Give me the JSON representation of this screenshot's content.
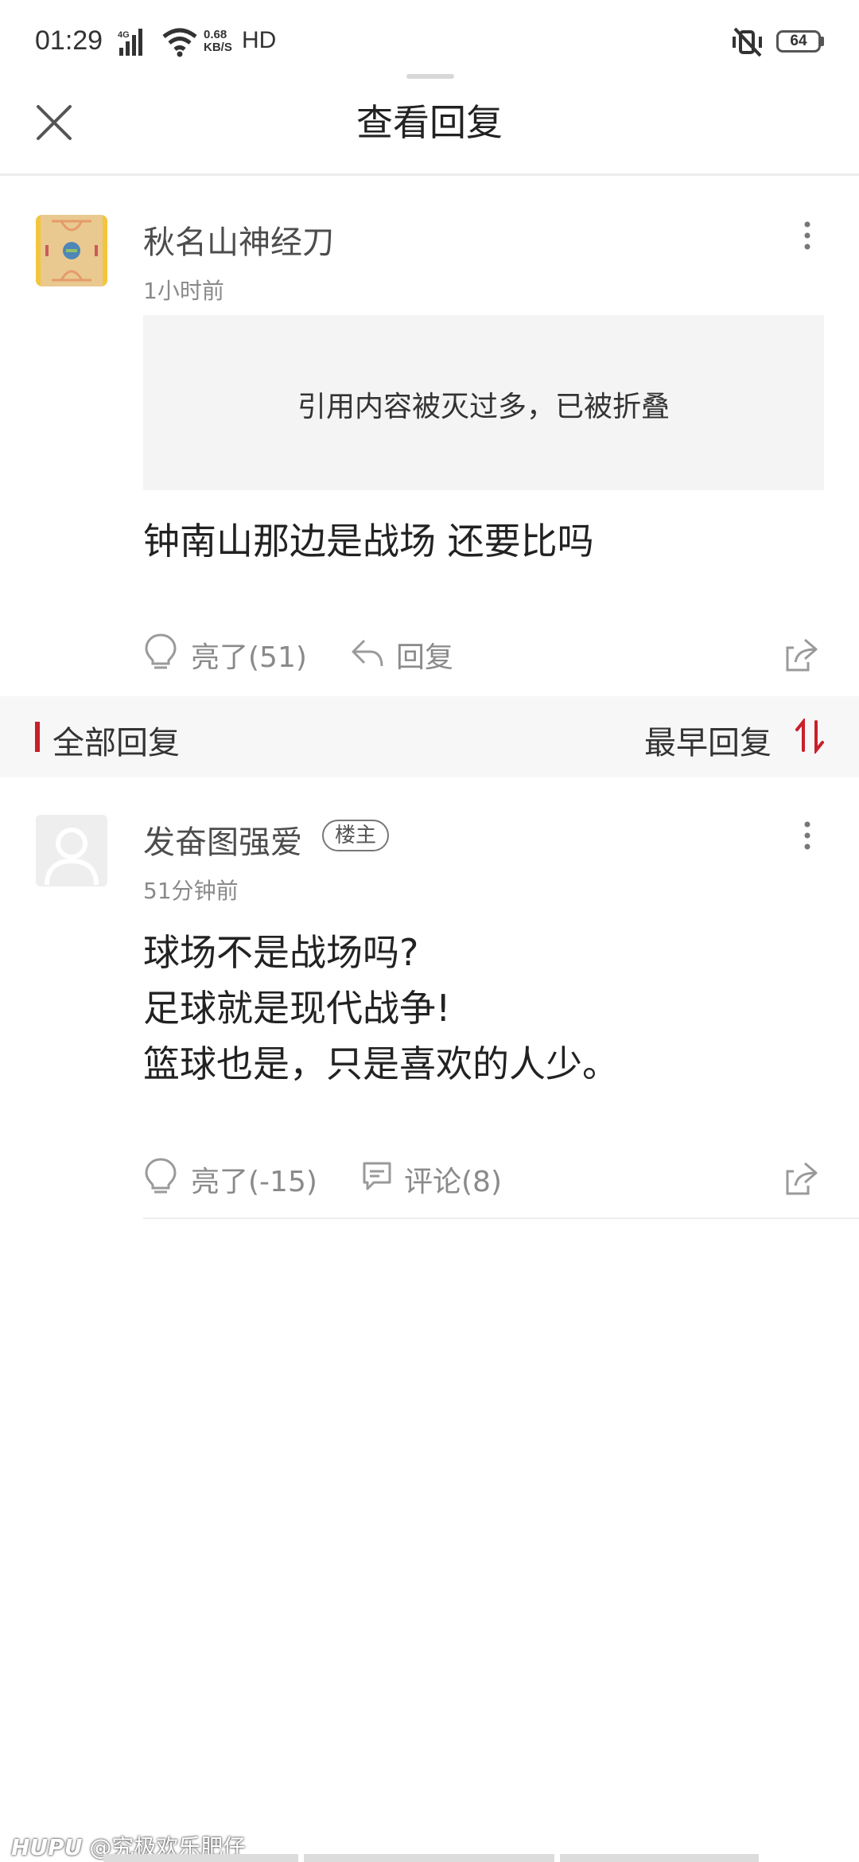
{
  "status_bar": {
    "time": "01:29",
    "network": "4G",
    "speed_value": "0.68",
    "speed_unit": "KB/S",
    "hd": "HD",
    "battery": "64"
  },
  "header": {
    "title": "查看回复",
    "close_icon": "close-icon"
  },
  "quoted_post": {
    "username": "秋名山神经刀",
    "time": "1小时前",
    "folded_notice": "引用内容被灭过多，已被折叠",
    "content": "钟南山那边是战场 还要比吗",
    "like_label": "亮了(51)",
    "reply_label": "回复"
  },
  "section": {
    "label": "全部回复",
    "sort_label": "最早回复",
    "accent_color": "#c8202a"
  },
  "replies": [
    {
      "username": "发奋图强爱",
      "badge": "楼主",
      "time": "51分钟前",
      "lines": [
        "球场不是战场吗?",
        "足球就是现代战争!",
        "篮球也是，只是喜欢的人少。"
      ],
      "like_label": "亮了(-15)",
      "comment_label": "评论(8)"
    }
  ],
  "watermark": {
    "brand": "HUPU",
    "text": "@究极欢乐肥仔"
  }
}
